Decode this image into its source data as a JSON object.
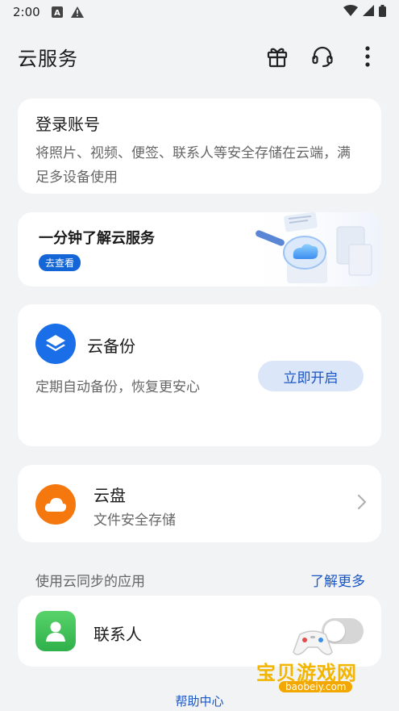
{
  "status_bar": {
    "time": "2:00",
    "icons": [
      "notification-a-icon",
      "warning-icon"
    ],
    "right_icons": [
      "wifi-icon",
      "signal-icon",
      "battery-icon"
    ]
  },
  "header": {
    "title": "云服务",
    "actions": [
      "gift-icon",
      "headset-icon",
      "more-vert-icon"
    ]
  },
  "login": {
    "title": "登录账号",
    "description": "将照片、视频、便签、联系人等安全存储在云端，满足多设备使用"
  },
  "intro": {
    "title": "一分钟了解云服务",
    "badge": "去查看"
  },
  "backup": {
    "title": "云备份",
    "description": "定期自动备份，恢复更安心",
    "button": "立即开启",
    "icon": "layers-icon",
    "icon_color": "#1a6ee8"
  },
  "drive": {
    "title": "云盘",
    "description": "文件安全存储",
    "icon": "cloud-icon",
    "icon_color": "#f5780f"
  },
  "sync_section": {
    "title": "使用云同步的应用",
    "more": "了解更多"
  },
  "contacts": {
    "label": "联系人",
    "toggle_on": false,
    "icon_color": "#2fb04a"
  },
  "help": {
    "label": "帮助中心"
  },
  "watermark": {
    "text": "宝贝游戏网",
    "url": "baobeiy.com"
  },
  "colors": {
    "accent": "#1a56c4",
    "background": "#f1f3f5"
  }
}
